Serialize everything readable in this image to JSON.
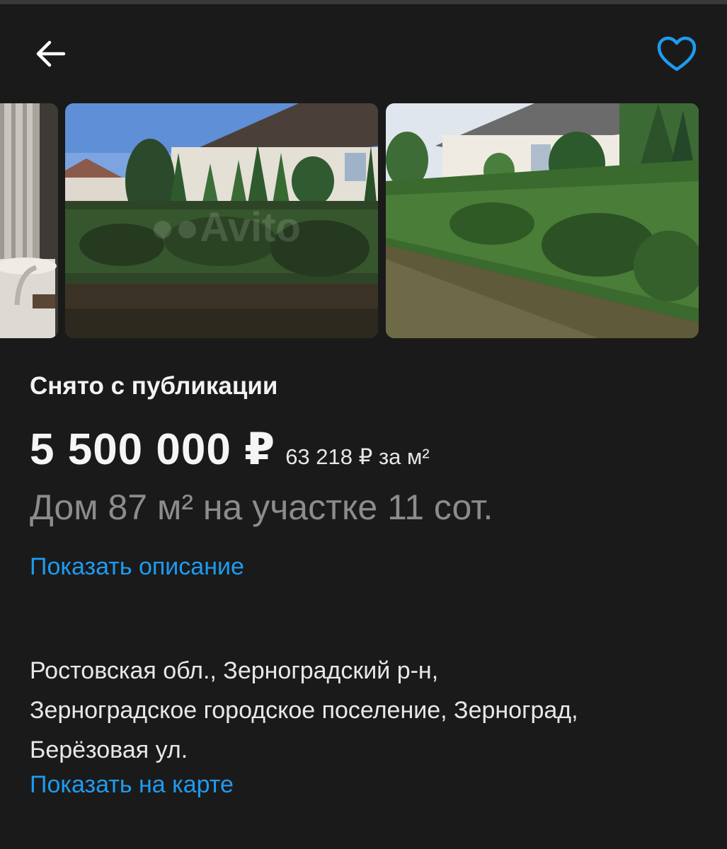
{
  "header": {
    "back_icon": "arrow-left-icon",
    "favorite_icon": "heart-outline-icon",
    "accent_color": "#1e9bf0"
  },
  "gallery": {
    "watermark": "Avito",
    "photos": [
      "interior-partial",
      "house-behind-hedge",
      "hedge-along-path"
    ]
  },
  "listing": {
    "status": "Снято с публикации",
    "price": "5 500 000 ₽",
    "price_per_m2": "63 218 ₽ за м²",
    "title": "Дом 87 м² на участке 11 сот.",
    "show_description": "Показать описание"
  },
  "address": {
    "line1": "Ростовская обл., Зерноградский р-н,",
    "line2": "Зерноградское городское поселение, Зерноград,",
    "line3": "Берёзовая ул.",
    "show_on_map": "Показать на карте"
  }
}
